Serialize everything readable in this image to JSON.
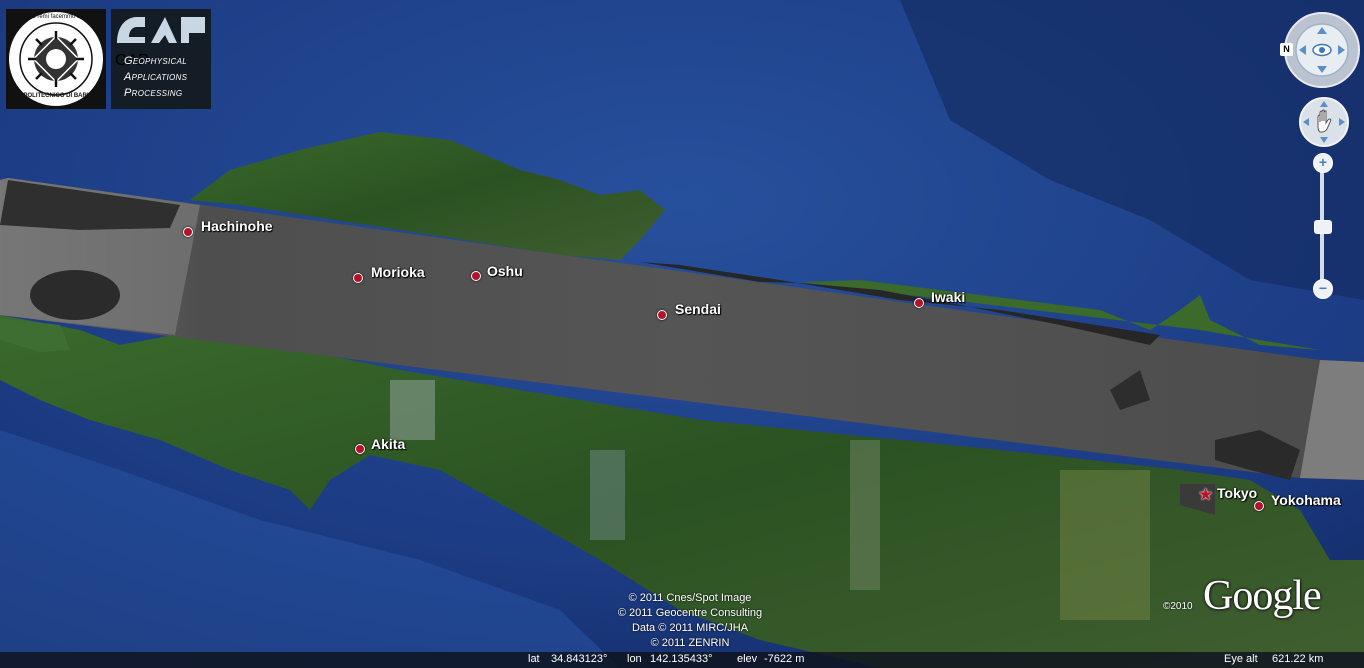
{
  "logos": {
    "poliba_top_text": "de remi facemmo ali",
    "poliba_bottom_text": "POLITECNICO DI BARI",
    "gap_mark": "GAP",
    "gap_line1": "Geophysical",
    "gap_line2": "Applications",
    "gap_line3": "Processing"
  },
  "places": [
    {
      "name": "Hachinohe",
      "kind": "pin"
    },
    {
      "name": "Morioka",
      "kind": "pin"
    },
    {
      "name": "Oshu",
      "kind": "pin"
    },
    {
      "name": "Sendai",
      "kind": "pin"
    },
    {
      "name": "Iwaki",
      "kind": "pin"
    },
    {
      "name": "Akita",
      "kind": "pin"
    },
    {
      "name": "Tokyo",
      "kind": "capital-star"
    },
    {
      "name": "Yokohama",
      "kind": "pin"
    }
  ],
  "navigation": {
    "north_button": "N",
    "look_icon": "eye-icon",
    "move_icon": "hand-icon",
    "zoom_in": "+",
    "zoom_out": "−"
  },
  "credits": [
    "© 2011 Cnes/Spot Image",
    "© 2011 Geocentre Consulting",
    "Data © 2011 MIRC/JHA",
    "© 2011 ZENRIN"
  ],
  "branding": {
    "copyright_year": "©2010",
    "google_logo": "Google"
  },
  "status": {
    "lat_label": "lat",
    "lat_value": "34.843123°",
    "lon_label": "lon",
    "lon_value": "142.135433°",
    "elev_label": "elev",
    "elev_value": "-7622 m",
    "eye_alt_label": "Eye alt",
    "eye_alt_value": "621.22 km"
  },
  "colors": {
    "ocean": "#1e3f86",
    "land": "#2f5a24",
    "sar_strip": "#5a5a5a",
    "pin": "#b3122a"
  }
}
